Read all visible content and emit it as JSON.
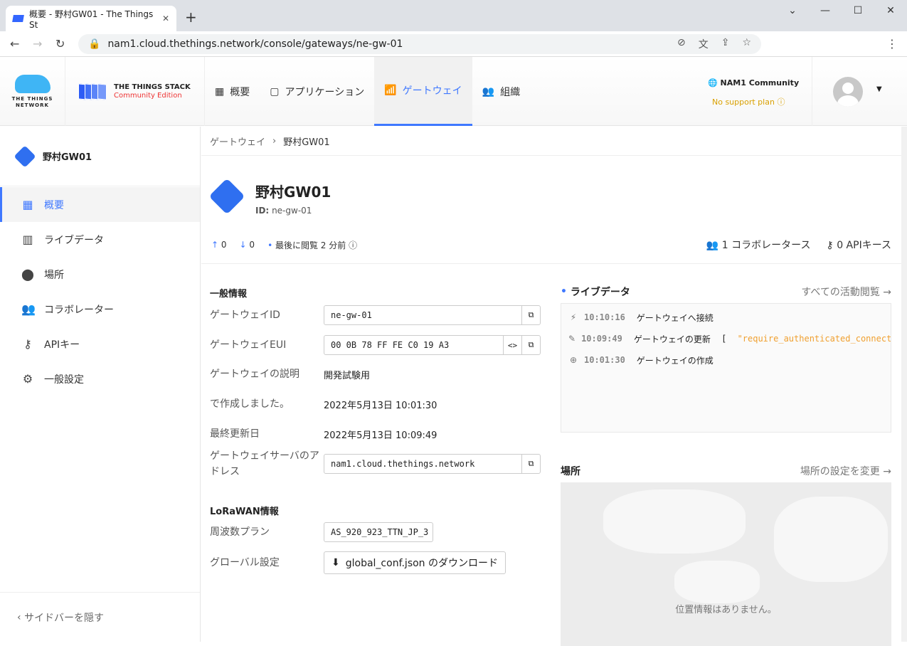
{
  "browser": {
    "tab_title": "概要 - 野村GW01 - The Things St",
    "url": "nam1.cloud.thethings.network/console/gateways/ne-gw-01"
  },
  "brand": {
    "ttn": "THE THINGS NETWORK",
    "stack": "THE THINGS STACK",
    "edition": "Community Edition",
    "accent": "#3f78ff"
  },
  "nav": [
    {
      "label": "概要",
      "icon": "dashboard-icon"
    },
    {
      "label": "アプリケーション",
      "icon": "application-icon"
    },
    {
      "label": "ゲートウェイ",
      "icon": "gateway-icon",
      "active": true
    },
    {
      "label": "組織",
      "icon": "organization-icon"
    }
  ],
  "cluster": {
    "name": "NAM1 Community",
    "plan": "No support plan"
  },
  "sidebar": {
    "gateway": "野村GW01",
    "items": [
      {
        "label": "概要",
        "active": true
      },
      {
        "label": "ライブデータ"
      },
      {
        "label": "場所"
      },
      {
        "label": "コラボレーター"
      },
      {
        "label": "APIキー"
      },
      {
        "label": "一般設定"
      }
    ],
    "hide": "サイドバーを隠す"
  },
  "breadcrumb": [
    "ゲートウェイ",
    "野村GW01"
  ],
  "gateway": {
    "name": "野村GW01",
    "id_label": "ID:",
    "id": "ne-gw-01",
    "up": "0",
    "down": "0",
    "last_seen": "最後に閲覧 2 分前",
    "collaborators": "1 コラボレータース",
    "api_keys": "0 APIキース"
  },
  "general": {
    "title": "一般情報",
    "gateway_id_label": "ゲートウェイID",
    "gateway_id": "ne-gw-01",
    "eui_label": "ゲートウェイEUI",
    "eui": "00 0B 78 FF FE C0 19 A3",
    "desc_label": "ゲートウェイの説明",
    "desc": "開発試験用",
    "created_label": "で作成しました。",
    "created": "2022年5月13日 10:01:30",
    "updated_label": "最終更新日",
    "updated": "2022年5月13日 10:09:49",
    "server_label": "ゲートウェイサーバのアドレス",
    "server": "nam1.cloud.thethings.network"
  },
  "lorawan": {
    "title": "LoRaWAN情報",
    "plan_label": "周波数プラン",
    "plan": "AS_920_923_TTN_JP_3",
    "global_label": "グローバル設定",
    "download": "global_conf.json のダウンロード"
  },
  "live": {
    "title": "ライブデータ",
    "link": "すべての活動閲覧 →",
    "events": [
      {
        "time": "10:10:16",
        "text": "ゲートウェイへ接続",
        "icon": "bolt-icon"
      },
      {
        "time": "10:09:49",
        "text": "ゲートウェイの更新",
        "extra": "\"require_authenticated_connectio",
        "icon": "pencil-icon"
      },
      {
        "time": "10:01:30",
        "text": "ゲートウェイの作成",
        "icon": "plus-circle-icon"
      }
    ]
  },
  "location": {
    "title": "場所",
    "link": "場所の設定を変更 →",
    "empty": "位置情報はありません。"
  }
}
